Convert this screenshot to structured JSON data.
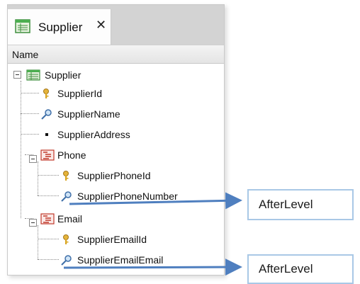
{
  "tab": {
    "label": "Supplier",
    "close": "✕",
    "icon": "transaction-table-icon"
  },
  "column_header": "Name",
  "tree": {
    "root": {
      "label": "Supplier",
      "icon": "transaction-table-icon"
    },
    "supplier_id": {
      "label": "SupplierId",
      "icon": "key-icon"
    },
    "supplier_name": {
      "label": "SupplierName",
      "icon": "magnifier-icon"
    },
    "supplier_address": {
      "label": "SupplierAddress",
      "icon": "bullet-icon"
    },
    "phone": {
      "label": "Phone",
      "icon": "level-icon"
    },
    "supplier_phone_id": {
      "label": "SupplierPhoneId",
      "icon": "key-icon"
    },
    "supplier_phone_number": {
      "label": "SupplierPhoneNumber",
      "icon": "magnifier-icon"
    },
    "email": {
      "label": "Email",
      "icon": "level-icon"
    },
    "supplier_email_id": {
      "label": "SupplierEmailId",
      "icon": "key-icon"
    },
    "supplier_email_email": {
      "label": "SupplierEmailEmail",
      "icon": "magnifier-icon"
    }
  },
  "callouts": {
    "first": "AfterLevel",
    "second": "AfterLevel"
  },
  "colors": {
    "arrow": "#4f7fbf",
    "callout_border": "#a9c8e6",
    "level_icon": "#c0392b",
    "key_icon": "#d9a520"
  }
}
